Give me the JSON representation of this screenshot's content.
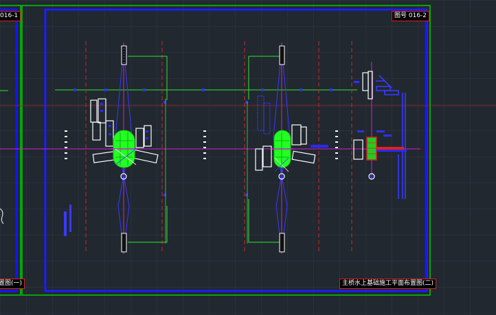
{
  "drawing": {
    "sheet_number_left": "016-1",
    "sheet_number_right": "图号 016-2",
    "sheet_title_left": "置图(一)",
    "sheet_title_right": "主桥水上基础施工平面布置图(二)"
  },
  "colors": {
    "background": "#212830",
    "frame_outer": "#00cc00",
    "frame_inner": "#1414ff",
    "centerline_red": "#c42020",
    "centerline_magenta": "#d21ed2",
    "piles": "#22ff22",
    "equipment": "#ffffff",
    "axis_blue": "#2a2aff"
  },
  "icons": [
    "crosshair-icon"
  ]
}
